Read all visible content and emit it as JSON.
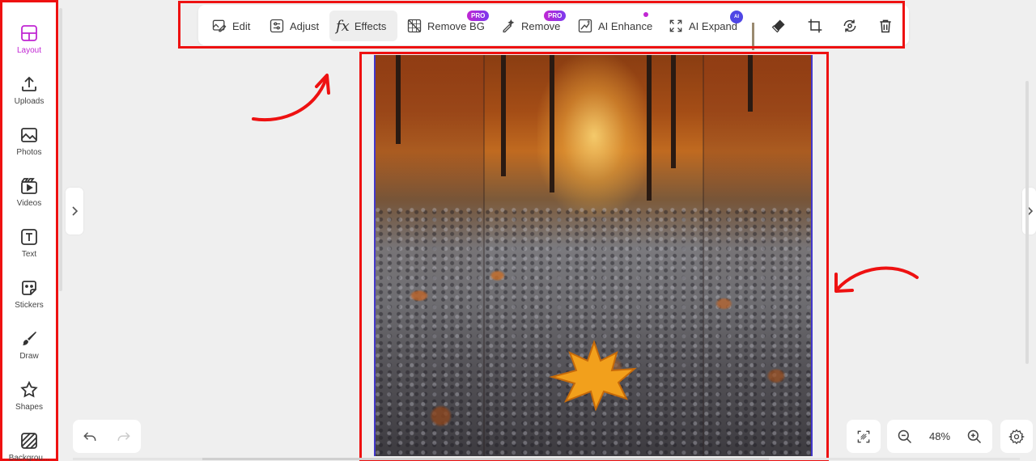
{
  "sidebar": {
    "items": [
      {
        "label": "Layout",
        "icon": "layout-icon",
        "active": true
      },
      {
        "label": "Uploads",
        "icon": "upload-icon"
      },
      {
        "label": "Photos",
        "icon": "photo-icon"
      },
      {
        "label": "Videos",
        "icon": "video-icon"
      },
      {
        "label": "Text",
        "icon": "text-icon"
      },
      {
        "label": "Stickers",
        "icon": "sticker-icon"
      },
      {
        "label": "Draw",
        "icon": "brush-icon"
      },
      {
        "label": "Shapes",
        "icon": "star-icon"
      },
      {
        "label": "Backgrou...",
        "icon": "background-icon"
      }
    ]
  },
  "toolbar": {
    "edit": "Edit",
    "adjust": "Adjust",
    "effects_glyph": "fx",
    "effects": "Effects",
    "remove_bg": "Remove BG",
    "remove_bg_badge": "PRO",
    "remove": "Remove",
    "remove_badge": "PRO",
    "ai_enhance": "AI Enhance",
    "ai_expand": "AI Expand",
    "ai_expand_badge": "AI",
    "active_tool": "Effects"
  },
  "zoom": {
    "value": "48%"
  },
  "colors": {
    "accent": "#c026d3",
    "highlight_outline": "#ee1111",
    "selection_border": "#4338ca"
  }
}
